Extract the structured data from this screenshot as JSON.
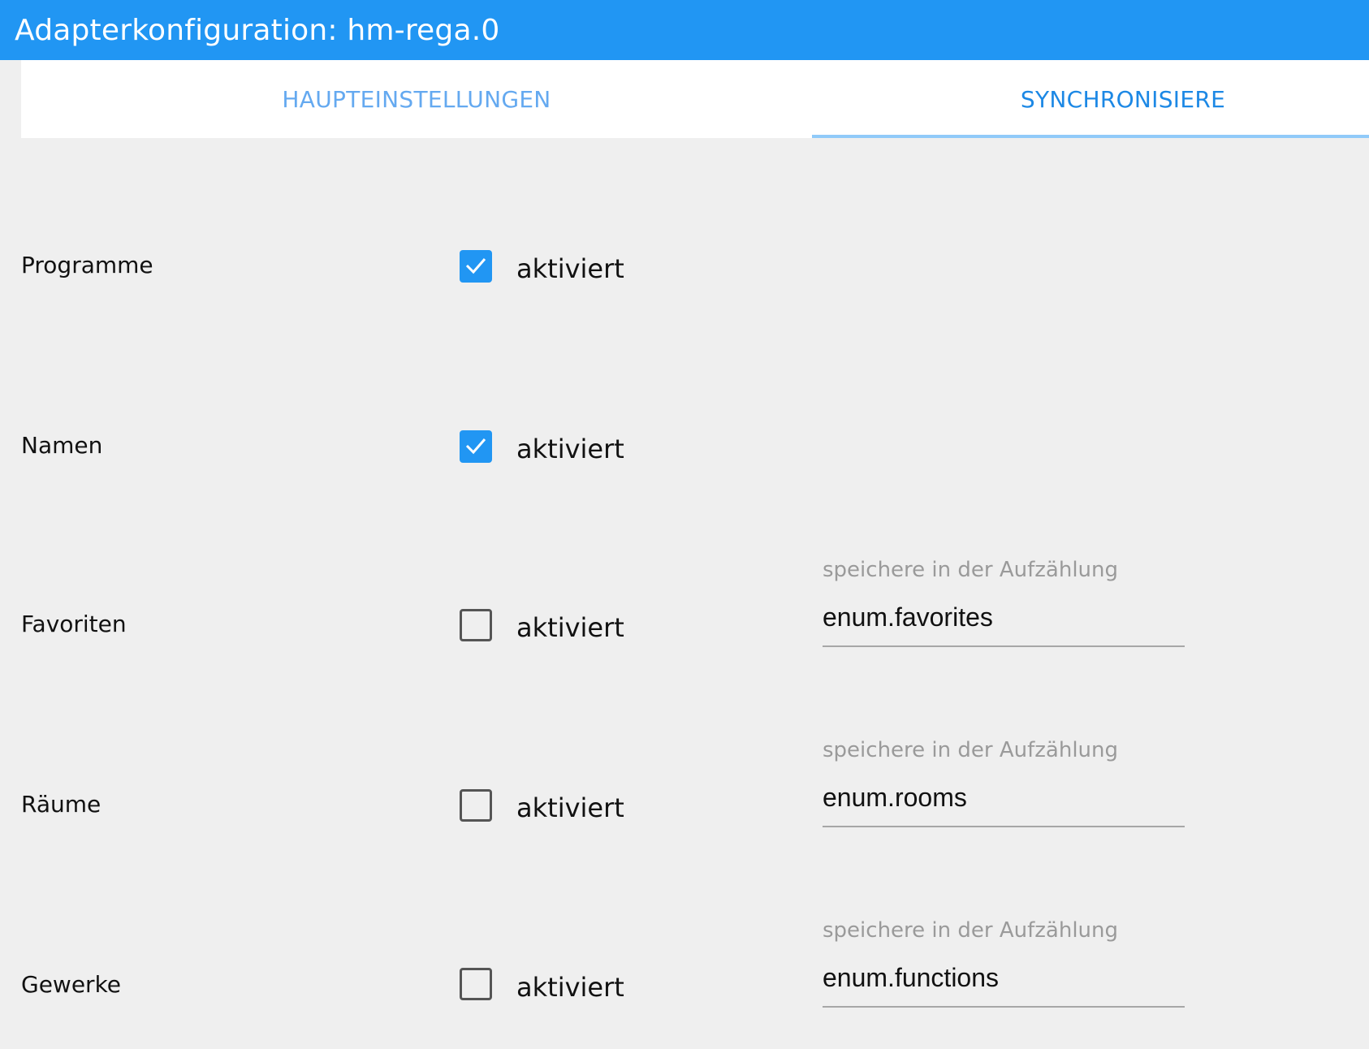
{
  "window": {
    "title": "Adapterkonfiguration: hm-rega.0"
  },
  "tabs": [
    {
      "label": "HAUPTEINSTELLUNGEN",
      "active": false
    },
    {
      "label": "SYNCHRONISIERE",
      "active": true
    }
  ],
  "rows": [
    {
      "label": "Programme",
      "checkbox_label": "aktiviert",
      "checked": true
    },
    {
      "label": "Namen",
      "checkbox_label": "aktiviert",
      "checked": true
    },
    {
      "label": "Favoriten",
      "checkbox_label": "aktiviert",
      "checked": false,
      "field": {
        "caption": "speichere in der Aufzählung",
        "value": "enum.favorites"
      }
    },
    {
      "label": "Räume",
      "checkbox_label": "aktiviert",
      "checked": false,
      "field": {
        "caption": "speichere in der Aufzählung",
        "value": "enum.rooms"
      }
    },
    {
      "label": "Gewerke",
      "checkbox_label": "aktiviert",
      "checked": false,
      "field": {
        "caption": "speichere in der Aufzählung",
        "value": "enum.functions"
      }
    }
  ],
  "colors": {
    "accent": "#2196f3",
    "tab_active_text": "#1c88e5",
    "tab_indicator": "#90caf9",
    "background": "#efefef"
  }
}
